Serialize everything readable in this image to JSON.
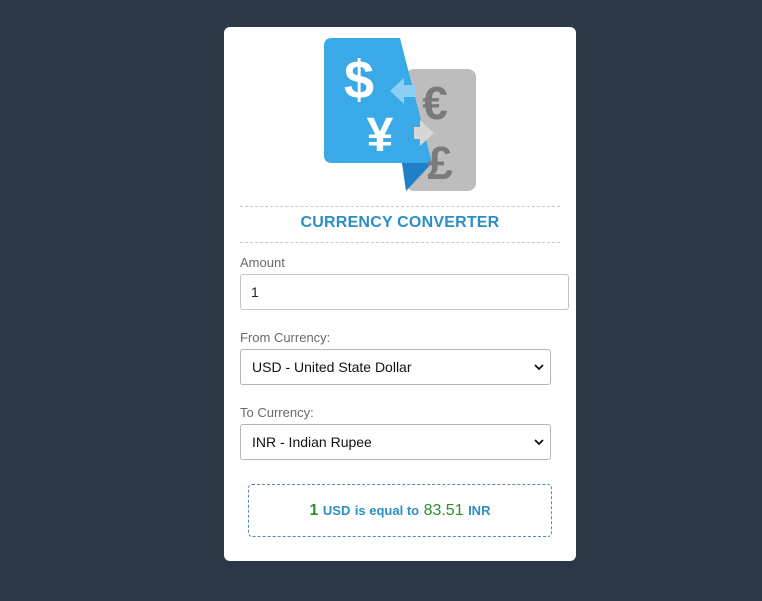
{
  "converter": {
    "title": "CURRENCY CONVERTER",
    "amount_label": "Amount",
    "amount_value": "1",
    "from_label": "From Currency:",
    "from_selected": "USD - United State Dollar",
    "to_label": "To Currency:",
    "to_selected": "INR - Indian Rupee"
  },
  "result": {
    "amount": "1",
    "from_code": "USD",
    "text": "is equal to",
    "converted": "83.51",
    "to_code": "INR"
  },
  "logo": {
    "icon": "currency-exchange-icon",
    "glyphs": [
      "$",
      "¥",
      "€",
      "£"
    ]
  },
  "colors": {
    "background": "#2c3848",
    "card": "#ffffff",
    "accent": "#2b8fc4",
    "result_number": "#2d8f2d",
    "logo_blue": "#3aa9e8",
    "logo_gray": "#bdbdbd"
  }
}
